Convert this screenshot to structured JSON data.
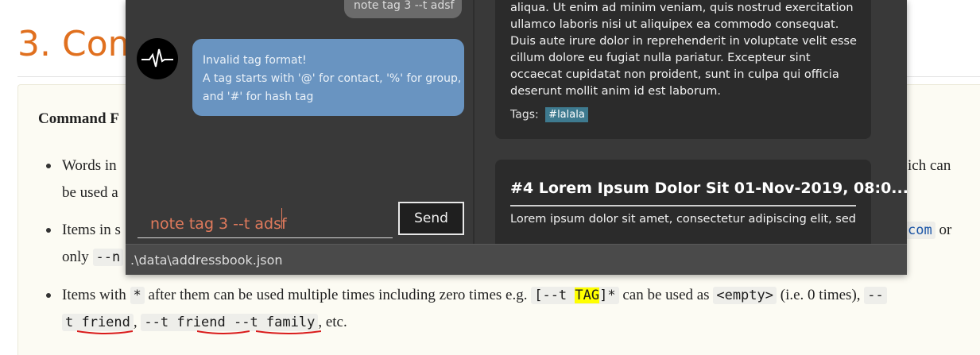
{
  "doc": {
    "heading": "3. Com",
    "command_format_label": "Command F",
    "bullet1": {
      "start": "Words in",
      "cont": "be used a",
      "right": "ich can"
    },
    "bullet2": {
      "start": "Items in s",
      "cont": "only",
      "code": "--n",
      "link_code": "com",
      "right": "or"
    },
    "bullet3": {
      "prefix": "Items with",
      "star": "*",
      "mid": "after them can be used multiple times including zero times e.g.",
      "code_open": "[--t",
      "code_hl": "TAG",
      "code_close": "]*",
      "mid2": "can be used as",
      "empty_code": "<empty>",
      "mid3": "(i.e. 0 times),",
      "dash_code": "--",
      "line2_code1": "t friend",
      "comma": ",",
      "line2_code2": "--t friend --t family",
      "tail": ", etc."
    }
  },
  "app": {
    "chat": {
      "user_message": "note tag 3 --t adsf",
      "bot_message_lines": [
        "Invalid tag format!",
        "A tag starts with '@' for contact, '%' for group,",
        "and '#' for hash tag"
      ]
    },
    "command_input": {
      "value": "note tag 3 --t adsf",
      "placeholder": ""
    },
    "send_label": "Send",
    "notes": [
      {
        "body_lines": [
          "aliqua. Ut enim ad minim veniam, quis nostrud exercitation",
          "ullamco laboris nisi ut aliquipex ea commodo consequat.",
          "Duis aute irure dolor in reprehenderit in voluptate velit esse",
          "cillum dolore eu fugiat nulla pariatur. Excepteur sint",
          "occaecat cupidatat non proident, sunt in culpa qui officia",
          "deserunt mollit anim id est laborum."
        ],
        "tags_label": "Tags:",
        "tags": [
          "#lalala"
        ]
      },
      {
        "title": "#4 Lorem Ipsum Dolor Sit  01-Nov-2019, 08:0...",
        "body": "Lorem ipsum dolor sit amet, consectetur adipiscing elit, sed"
      }
    ],
    "status_path": ".\\data\\addressbook.json"
  },
  "colors": {
    "heading": "#e0701f",
    "app_bg": "#393939",
    "bot_bubble": "#6994c1",
    "user_bubble": "#6b6b6b",
    "input_text": "#e07a5c",
    "tag_chip": "#3e7a8f",
    "highlight": "#ffff00"
  }
}
